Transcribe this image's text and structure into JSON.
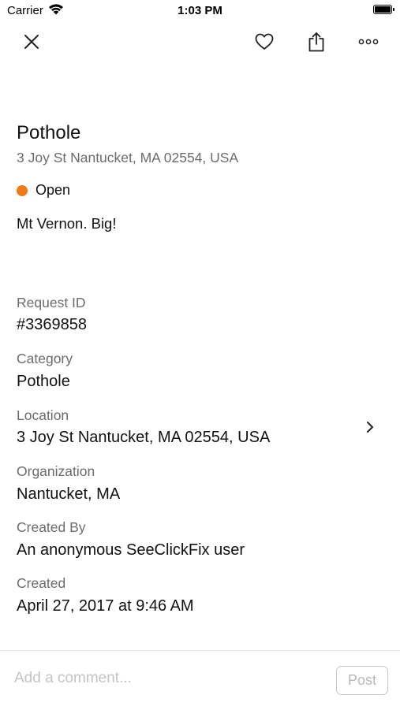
{
  "status_bar": {
    "carrier": "Carrier",
    "time": "1:03 PM"
  },
  "nav": {
    "icons": [
      "close-icon",
      "heart-icon",
      "share-icon",
      "more-icon"
    ]
  },
  "issue": {
    "title": "Pothole",
    "address": "3 Joy St Nantucket, MA 02554, USA",
    "status": "Open",
    "status_color": "#f07a13",
    "description": "Mt Vernon. Big!"
  },
  "details": {
    "request_id": {
      "label": "Request ID",
      "value": "#3369858"
    },
    "category": {
      "label": "Category",
      "value": "Pothole"
    },
    "location": {
      "label": "Location",
      "value": "3 Joy St Nantucket, MA 02554, USA"
    },
    "organization": {
      "label": "Organization",
      "value": "Nantucket, MA"
    },
    "created_by": {
      "label": "Created By",
      "value": "An anonymous SeeClickFix user"
    },
    "created": {
      "label": "Created",
      "value": "April 27, 2017 at 9:46 AM"
    }
  },
  "comment": {
    "placeholder": "Add a comment...",
    "value": "",
    "post_label": "Post"
  }
}
